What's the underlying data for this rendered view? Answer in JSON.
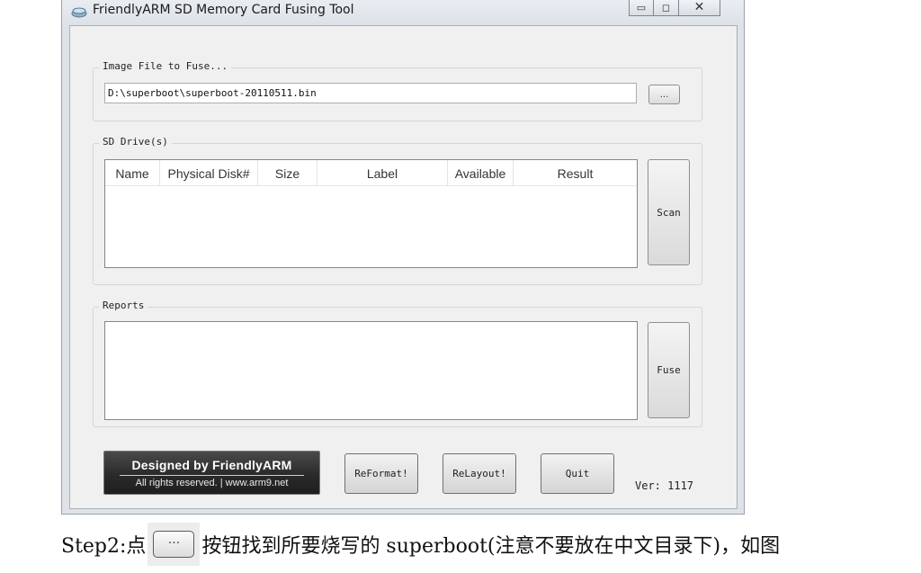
{
  "window": {
    "title": "FriendlyARM SD Memory Card Fusing Tool",
    "icon": "sd-card-icon",
    "controls": {
      "minimize": "▭",
      "maximize": "◻",
      "close": "✕"
    }
  },
  "image_file": {
    "group_label": "Image File to Fuse...",
    "path_value": "D:\\superboot\\superboot-20110511.bin",
    "browse_label": "..."
  },
  "sd_drives": {
    "group_label": "SD Drive(s)",
    "columns": [
      "Name",
      "Physical Disk#",
      "Size",
      "Label",
      "Available",
      "Result"
    ],
    "rows": [],
    "scan_label": "Scan"
  },
  "reports": {
    "group_label": "Reports",
    "content": "",
    "fuse_label": "Fuse"
  },
  "footer": {
    "brand_title": "Designed by FriendlyARM",
    "brand_sub": "All rights reserved. | www.arm9.net",
    "reformat_label": "ReFormat!",
    "relayout_label": "ReLayout!",
    "quit_label": "Quit",
    "version": "Ver: 1117"
  },
  "caption": {
    "prefix": "Step2:点",
    "button_glyph": "...",
    "suffix": "按钮找到所要烧写的 superboot(注意不要放在中文目录下)，如图"
  },
  "colors": {
    "window_bg": "#f0f0f0",
    "frame": "#dfe3e8",
    "brand_bg": "#2a2a2a"
  }
}
